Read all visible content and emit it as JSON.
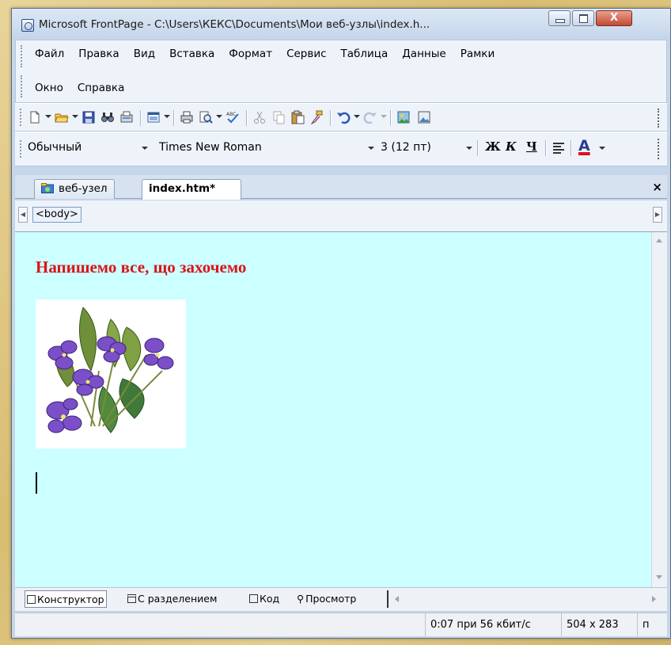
{
  "window": {
    "title": "Microsoft FrontPage - C:\\Users\\КЕКС\\Documents\\Мои веб-узлы\\index.h...",
    "close_label": "X"
  },
  "menu": {
    "row1": [
      "Файл",
      "Правка",
      "Вид",
      "Вставка",
      "Формат",
      "Сервис",
      "Таблица",
      "Данные",
      "Рамки"
    ],
    "row2": [
      "Окно",
      "Справка"
    ]
  },
  "toolbar": {
    "icons": [
      "new-page-icon",
      "open-folder-icon",
      "save-icon",
      "search-icon",
      "publish-icon",
      "web-component-icon",
      "print-icon",
      "print-preview-icon",
      "spelling-icon",
      "cut-icon",
      "copy-icon",
      "paste-icon",
      "format-painter-icon",
      "undo-icon",
      "redo-icon",
      "picture-icon",
      "image-icon"
    ]
  },
  "format_toolbar": {
    "style": "Обычный",
    "font": "Times New Roman",
    "size": "3  (12 пт)",
    "bold": "Ж",
    "italic": "К",
    "underline": "Ч",
    "font_color": "A",
    "font_color_hex": "#e0101a"
  },
  "tabs": [
    {
      "label": "веб-узел"
    },
    {
      "label": "index.htm*"
    }
  ],
  "tab_close": "×",
  "tag_selector": "<body>",
  "document": {
    "heading": "Напишемо все, що захочемо",
    "heading_color": "#d9141a",
    "background": "#ccffff"
  },
  "views": [
    {
      "label": "Конструктор"
    },
    {
      "label": "С разделением"
    },
    {
      "label": "Код"
    },
    {
      "label": "Просмотр"
    }
  ],
  "status": {
    "download_time": "0:07 при 56 кбит/с",
    "page_size": "504 x 283",
    "mode": "п"
  }
}
